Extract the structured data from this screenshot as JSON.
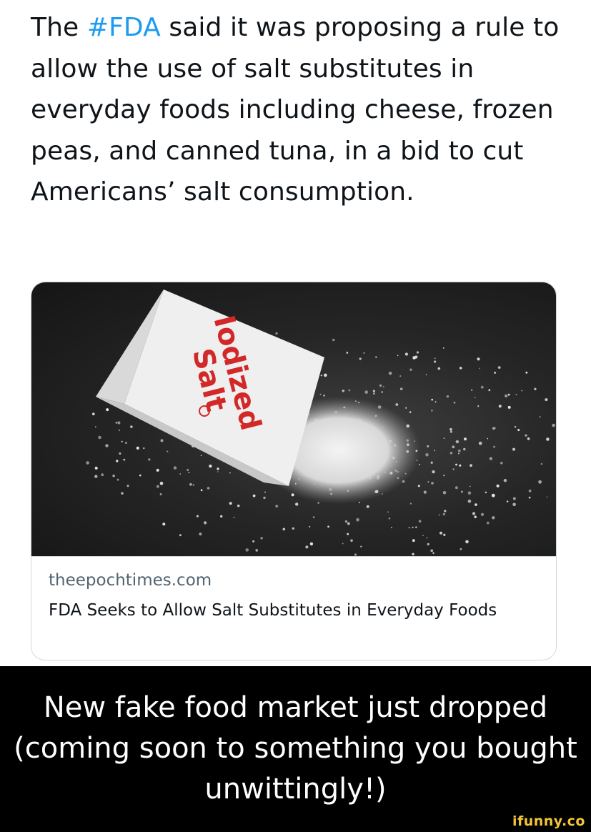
{
  "tweet": {
    "text_before": "The ",
    "hashtag": "#FDA",
    "text_after": " said it was proposing a rule to allow the use of salt substitutes in everyday foods including cheese, frozen peas, and canned tuna, in a bid to cut Americans’ salt consumption."
  },
  "card": {
    "packet_label_1": "Iodized",
    "packet_label_2": "Salt",
    "domain": "theepochtimes.com",
    "title": "FDA Seeks to Allow Salt Substitutes in Everyday Foods"
  },
  "caption": "New fake food market just dropped (coming soon to something you bought unwittingly!)",
  "watermark": "ifunny.co",
  "colors": {
    "hashtag": "#1d9bf0",
    "caption_background": "#000000",
    "watermark": "#f3c43c"
  }
}
